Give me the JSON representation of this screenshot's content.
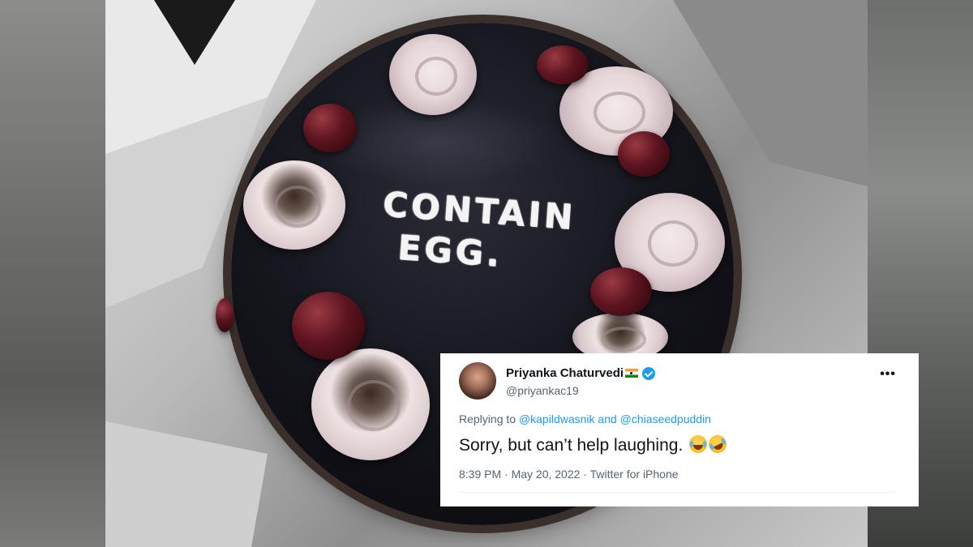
{
  "photo": {
    "cake_text_line1": "CONTAIN",
    "cake_text_line2": "EGG."
  },
  "tweet": {
    "display_name": "Priyanka Chaturvedi",
    "handle": "@priyankac19",
    "more_icon": "•••",
    "replying_prefix": "Replying to",
    "reply_user_1": "@kapildwasnik",
    "reply_and": "and",
    "reply_user_2": "@chiaseedpuddin",
    "text": "Sorry, but can’t help laughing.",
    "emojis": [
      "face-with-tears-of-joy",
      "rolling-on-floor-laughing"
    ],
    "timestamp": "8:39 PM · May 20, 2022 · Twitter for iPhone",
    "colors": {
      "link": "#1d9bf0",
      "verified": "#1d9bf0",
      "secondary_text": "#536471"
    }
  }
}
